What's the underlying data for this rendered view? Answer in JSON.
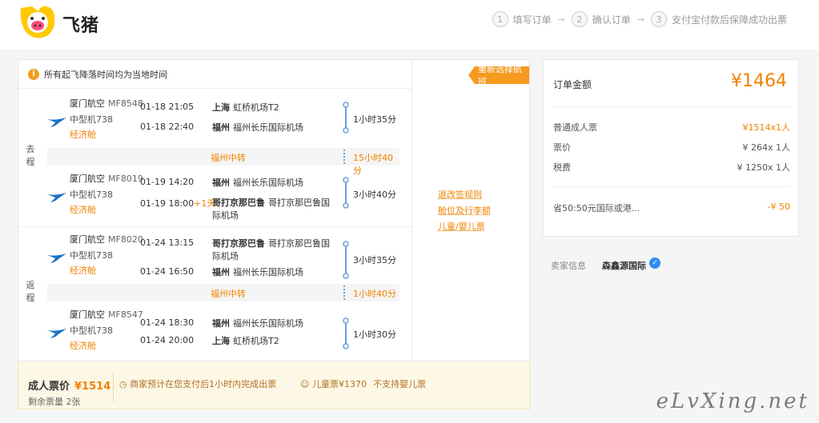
{
  "brand": {
    "name": "飞猪"
  },
  "steps": [
    {
      "num": "1",
      "label": "填写订单"
    },
    {
      "num": "2",
      "label": "确认订单"
    },
    {
      "num": "3",
      "label": "支付宝付款后保障成功出票"
    }
  ],
  "notice": "所有起飞降落时间均为当地时间",
  "reselect_button": "重新选择航班",
  "rules": [
    "退改签规则",
    "舱位及行李额",
    "儿童/婴儿票"
  ],
  "outbound": {
    "label": "去程",
    "segments": [
      {
        "airline": "厦门航空",
        "flight_no": "MF8548",
        "plane": "中型机738",
        "cabin": "经济舱",
        "dep_time": "01-18 21:05",
        "arr_time": "01-18 22:40",
        "arr_plus": "",
        "dep_city": "上海",
        "dep_airport": "虹桥机场T2",
        "arr_city": "福州",
        "arr_airport": "福州长乐国际机场",
        "duration": "1小时35分"
      },
      {
        "airline": "厦门航空",
        "flight_no": "MF8019",
        "plane": "中型机738",
        "cabin": "经济舱",
        "dep_time": "01-19 14:20",
        "arr_time": "01-19 18:00",
        "arr_plus": "+1天",
        "dep_city": "福州",
        "dep_airport": "福州长乐国际机场",
        "arr_city": "哥打京那巴鲁",
        "arr_airport": "哥打京那巴鲁国际机场",
        "duration": "3小时40分"
      }
    ],
    "transfer": {
      "city": "福州中转",
      "duration": "15小时40分"
    }
  },
  "return": {
    "label": "返程",
    "segments": [
      {
        "airline": "厦门航空",
        "flight_no": "MF8020",
        "plane": "中型机738",
        "cabin": "经济舱",
        "dep_time": "01-24 13:15",
        "arr_time": "01-24 16:50",
        "arr_plus": "",
        "dep_city": "哥打京那巴鲁",
        "dep_airport": "哥打京那巴鲁国际机场",
        "arr_city": "福州",
        "arr_airport": "福州长乐国际机场",
        "duration": "3小时35分"
      },
      {
        "airline": "厦门航空",
        "flight_no": "MF8547",
        "plane": "中型机738",
        "cabin": "经济舱",
        "dep_time": "01-24 18:30",
        "arr_time": "01-24 20:00",
        "arr_plus": "",
        "dep_city": "福州",
        "dep_airport": "福州长乐国际机场",
        "arr_city": "上海",
        "arr_airport": "虹桥机场T2",
        "duration": "1小时30分"
      }
    ],
    "transfer": {
      "city": "福州中转",
      "duration": "1小时40分"
    }
  },
  "bottom": {
    "adult_label": "成人票价",
    "adult_price": "¥1514",
    "remaining": "剩余票量 2张",
    "promise": "商家预计在您支付后1小时内完成出票",
    "child_price": "儿童票¥1370",
    "no_infant": "不支持婴儿票"
  },
  "order": {
    "total_label": "订单金额",
    "total": "¥1464",
    "rows": [
      {
        "label": "普通成人票",
        "value": "¥1514x1人",
        "orange": true
      },
      {
        "label": "票价",
        "value": "¥ 264x 1人",
        "orange": false
      },
      {
        "label": "税费",
        "value": "¥ 1250x 1人",
        "orange": false
      }
    ],
    "discount_label": "省50:50元国际或港...",
    "discount_value": "-¥ 50"
  },
  "seller": {
    "label": "卖家信息",
    "name": "森鑫源国际"
  },
  "watermark": "eLvXing.net",
  "colors": {
    "accent": "#f08200",
    "button": "#f59a1f",
    "flight_line": "#6aa0d8",
    "airline_logo": "#1a72c9"
  }
}
